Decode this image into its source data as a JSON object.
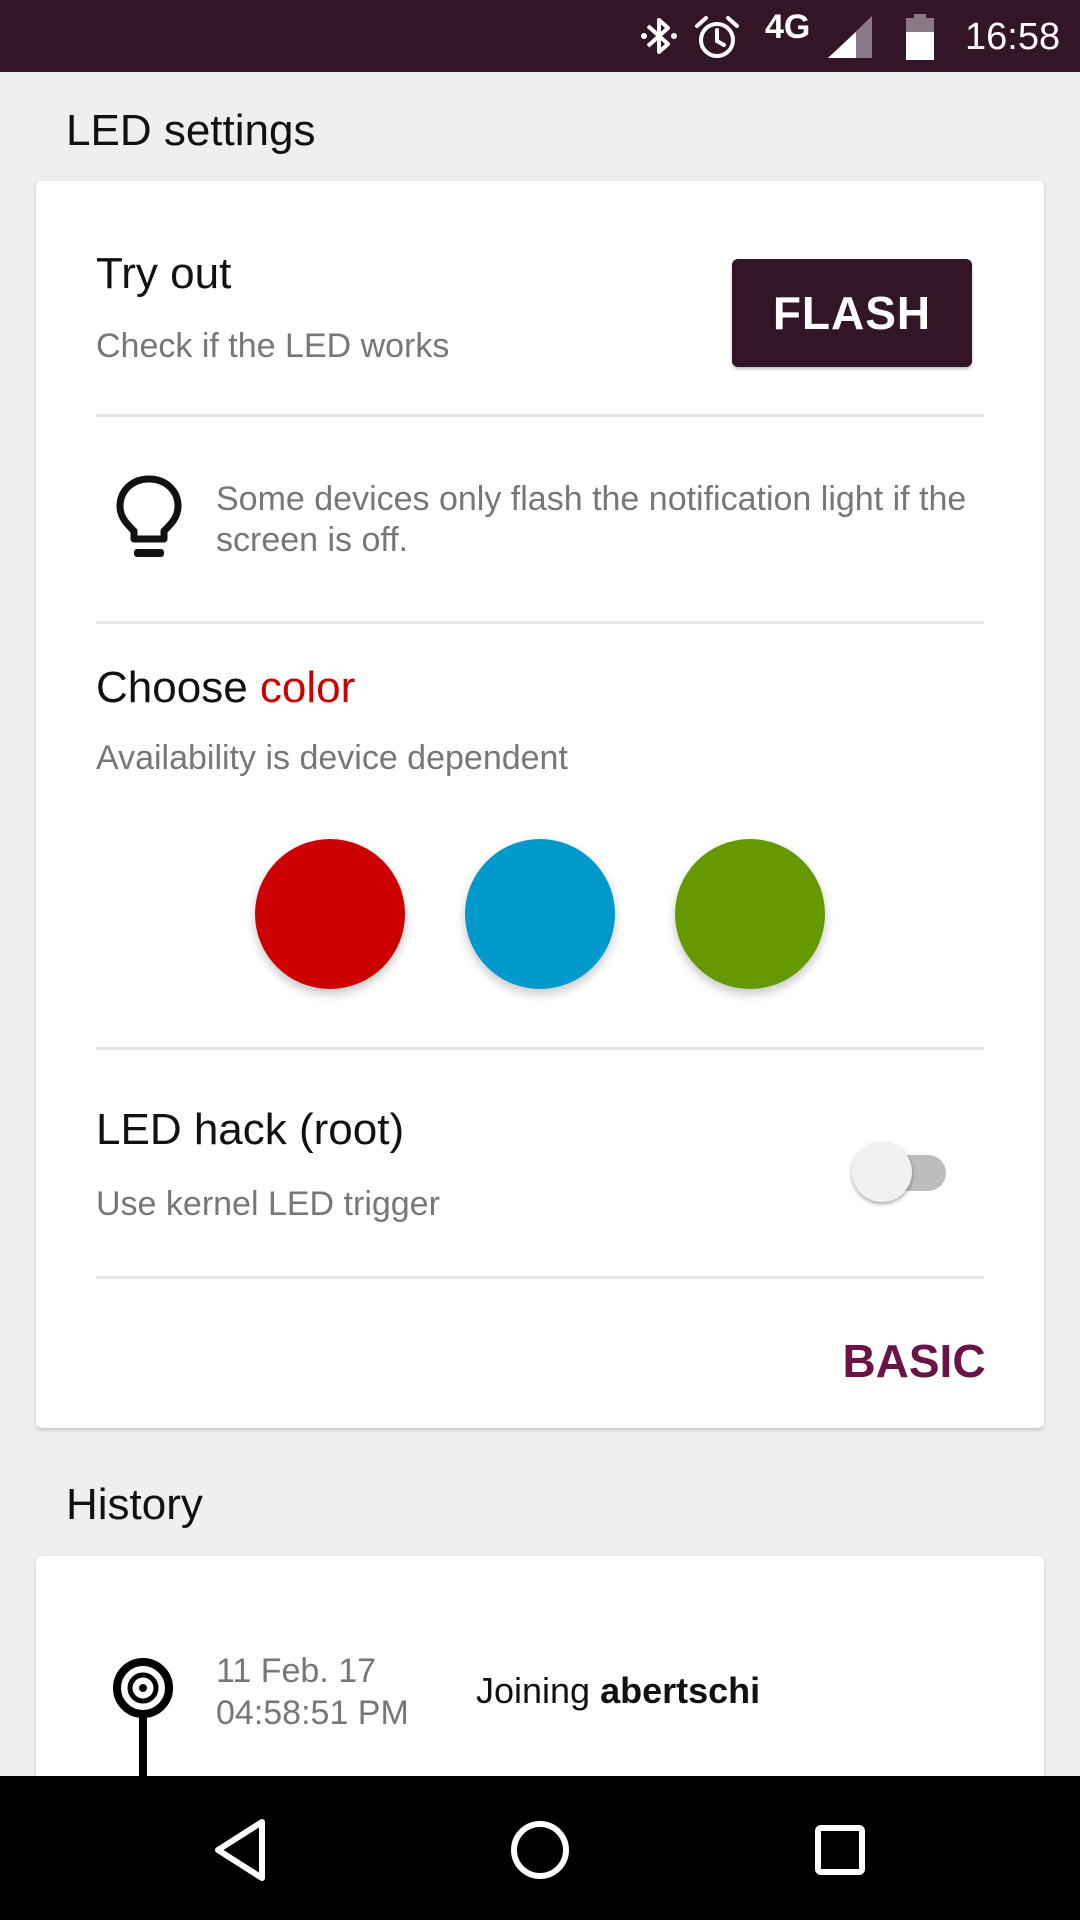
{
  "status_bar": {
    "network": "4G",
    "time": "16:58",
    "icons": [
      "bluetooth-icon",
      "alarm-icon",
      "signal-icon",
      "battery-icon"
    ]
  },
  "led_settings": {
    "section_title": "LED settings",
    "try_out": {
      "title": "Try out",
      "subtitle": "Check if the LED works",
      "button_label": "FLASH"
    },
    "tip": {
      "icon": "lightbulb-icon",
      "text": "Some devices only flash the notification light if the screen is off."
    },
    "choose_color": {
      "title_prefix": "Choose ",
      "title_accent": "color",
      "subtitle": "Availability is device dependent",
      "colors": [
        "#cc0000",
        "#0099cc",
        "#669900"
      ]
    },
    "led_hack": {
      "title": "LED hack (root)",
      "subtitle": "Use kernel LED trigger",
      "enabled": false
    },
    "mode_button_label": "BASIC"
  },
  "history": {
    "section_title": "History",
    "entries": [
      {
        "date": "11 Feb. 17",
        "time": "04:58:51 PM",
        "action": "Joining",
        "user": "abertschi"
      }
    ]
  },
  "colors": {
    "primary_dark": "#331528",
    "accent": "#cc0000",
    "mode_button": "#6a1346"
  }
}
